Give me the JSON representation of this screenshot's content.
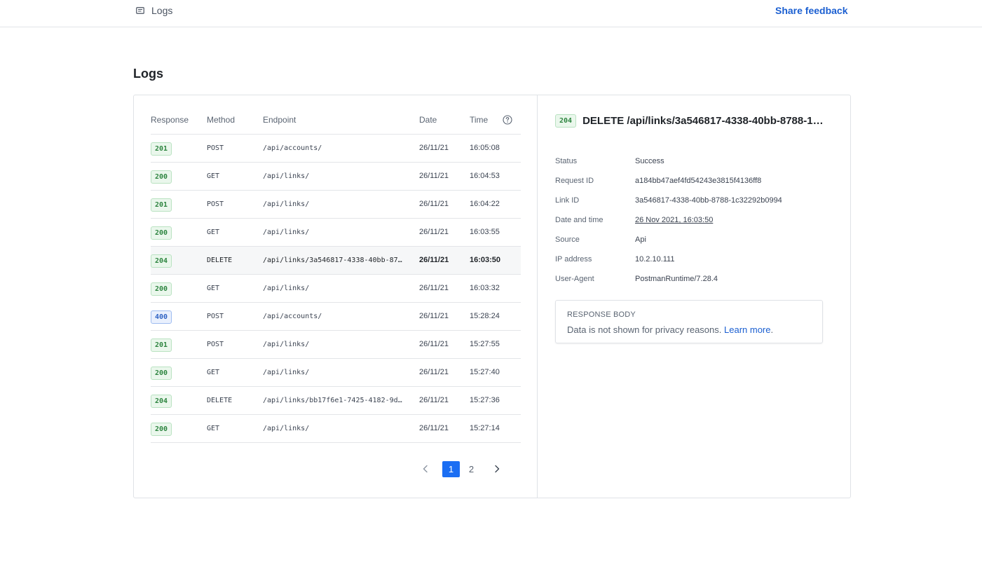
{
  "topbar": {
    "breadcrumb_label": "Logs",
    "breadcrumb_icon": "logs-icon",
    "feedback_label": "Share feedback"
  },
  "page": {
    "title": "Logs"
  },
  "table": {
    "headers": {
      "response": "Response",
      "method": "Method",
      "endpoint": "Endpoint",
      "date": "Date",
      "time": "Time",
      "help_icon": "help-circle-icon"
    },
    "rows": [
      {
        "status": "201",
        "method": "POST",
        "endpoint": "/api/accounts/",
        "date": "26/11/21",
        "time": "16:05:08",
        "selected": false
      },
      {
        "status": "200",
        "method": "GET",
        "endpoint": "/api/links/",
        "date": "26/11/21",
        "time": "16:04:53",
        "selected": false
      },
      {
        "status": "201",
        "method": "POST",
        "endpoint": "/api/links/",
        "date": "26/11/21",
        "time": "16:04:22",
        "selected": false
      },
      {
        "status": "200",
        "method": "GET",
        "endpoint": "/api/links/",
        "date": "26/11/21",
        "time": "16:03:55",
        "selected": false
      },
      {
        "status": "204",
        "method": "DELETE",
        "endpoint": "/api/links/3a546817-4338-40bb-87…",
        "date": "26/11/21",
        "time": "16:03:50",
        "selected": true
      },
      {
        "status": "200",
        "method": "GET",
        "endpoint": "/api/links/",
        "date": "26/11/21",
        "time": "16:03:32",
        "selected": false
      },
      {
        "status": "400",
        "method": "POST",
        "endpoint": "/api/accounts/",
        "date": "26/11/21",
        "time": "15:28:24",
        "selected": false
      },
      {
        "status": "201",
        "method": "POST",
        "endpoint": "/api/links/",
        "date": "26/11/21",
        "time": "15:27:55",
        "selected": false
      },
      {
        "status": "200",
        "method": "GET",
        "endpoint": "/api/links/",
        "date": "26/11/21",
        "time": "15:27:40",
        "selected": false
      },
      {
        "status": "204",
        "method": "DELETE",
        "endpoint": "/api/links/bb17f6e1-7425-4182-9d…",
        "date": "26/11/21",
        "time": "15:27:36",
        "selected": false
      },
      {
        "status": "200",
        "method": "GET",
        "endpoint": "/api/links/",
        "date": "26/11/21",
        "time": "15:27:14",
        "selected": false
      }
    ]
  },
  "pagination": {
    "prev_icon": "chevron-left-icon",
    "next_icon": "chevron-right-icon",
    "pages": [
      "1",
      "2"
    ],
    "current": "1"
  },
  "detail": {
    "status_code": "204",
    "title": "DELETE /api/links/3a546817-4338-40bb-8788-1…",
    "fields": [
      {
        "label": "Status",
        "value": "Success",
        "link": false
      },
      {
        "label": "Request ID",
        "value": "a184bb47aef4fd54243e3815f4136ff8",
        "link": false
      },
      {
        "label": "Link ID",
        "value": "3a546817-4338-40bb-8788-1c32292b0994",
        "link": false
      },
      {
        "label": "Date and time",
        "value": "26 Nov 2021, 16:03:50",
        "link": true
      },
      {
        "label": "Source",
        "value": "Api",
        "link": false
      },
      {
        "label": "IP address",
        "value": "10.2.10.111",
        "link": false
      },
      {
        "label": "User-Agent",
        "value": "PostmanRuntime/7.28.4",
        "link": false
      }
    ],
    "response_body": {
      "label": "RESPONSE BODY",
      "message": "Data is not shown for privacy reasons.",
      "learn_more": "Learn more",
      "suffix": "."
    }
  },
  "colors": {
    "accent": "#1b6ef3",
    "link": "#1b5fd1",
    "success_badge": "#2e8540",
    "client_error_badge": "#2f63c4"
  }
}
